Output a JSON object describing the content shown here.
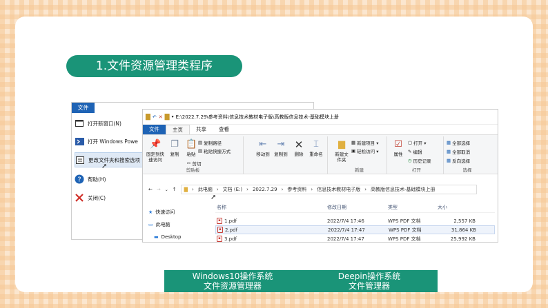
{
  "slide": {
    "title": "1.文件资源管理类程序"
  },
  "file_menu": {
    "tab_label": "文件",
    "items": [
      {
        "label": "打开新窗口(N)",
        "icon": "window-icon"
      },
      {
        "label": "打开 Windows Powe",
        "icon": "powershell-icon"
      },
      {
        "label": "更改文件夹和搜索选项",
        "icon": "options-icon"
      },
      {
        "label": "帮助(H)",
        "icon": "help-icon"
      },
      {
        "label": "关闭(C)",
        "icon": "close-x-icon"
      }
    ]
  },
  "explorer": {
    "title_path": "E:\\2022.7.29\\参考资料\\信息技术教材电子版\\高教版信息技术-基础模块上册",
    "tabs": [
      "文件",
      "主页",
      "共享",
      "查看"
    ],
    "ribbon": {
      "clipboard": {
        "label": "剪贴板",
        "pin": "固定到快速访问",
        "copy": "复制",
        "paste": "粘贴",
        "cut": "剪切",
        "copy_path": "复制路径",
        "paste_shortcut": "粘贴快捷方式"
      },
      "organize": {
        "move_to": "移动到",
        "copy_to": "复制到",
        "delete": "删除",
        "rename": "重命名"
      },
      "new": {
        "label": "新建",
        "new_folder": "新建文件夹",
        "new_item": "新建项目 ▾",
        "easy_access": "轻松访问 ▾"
      },
      "open": {
        "label": "打开",
        "properties": "属性",
        "open_btn": "打开 ▾",
        "edit": "编辑",
        "history": "历史记录"
      },
      "select": {
        "label": "选择",
        "select_all": "全部选择",
        "select_none": "全部取消",
        "invert": "反向选择"
      }
    },
    "address": [
      "此电脑",
      "文档 (E:)",
      "2022.7.29",
      "参考资料",
      "信息技术教材电子版",
      "高教版信息技术-基础模块上册"
    ],
    "nav": [
      {
        "label": "快速访问",
        "icon": "star-icon",
        "indent": false
      },
      {
        "label": "此电脑",
        "icon": "computer-icon",
        "indent": false
      },
      {
        "label": "Desktop",
        "icon": "desktop-icon",
        "indent": true
      }
    ],
    "columns": [
      "名称",
      "修改日期",
      "类型",
      "大小"
    ],
    "files": [
      {
        "name": "1.pdf",
        "date": "2022/7/4 17:46",
        "type": "WPS PDF 文档",
        "size": "2,557 KB"
      },
      {
        "name": "2.pdf",
        "date": "2022/7/4 17:47",
        "type": "WPS PDF 文档",
        "size": "31,864 KB"
      },
      {
        "name": "3.pdf",
        "date": "2022/7/4 17:47",
        "type": "WPS PDF 文档",
        "size": "25,992 KB"
      }
    ]
  },
  "captions": {
    "left_line1": "Windows10操作系统",
    "left_line2": "文件资源管理器",
    "right_line1": "Deepin操作系统",
    "right_line2": "文件管理器"
  },
  "colors": {
    "accent": "#1a9478",
    "file_tab": "#1e63b5"
  }
}
